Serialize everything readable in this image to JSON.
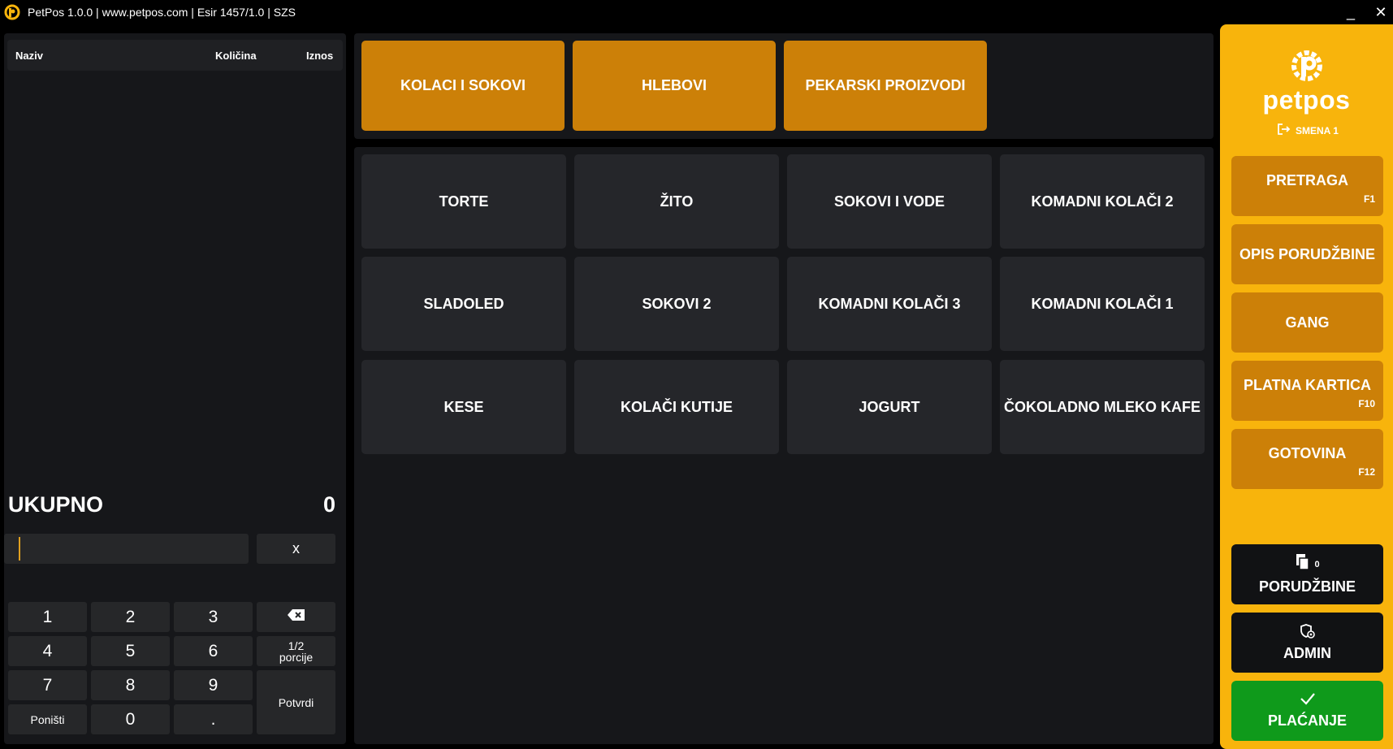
{
  "window": {
    "title": "PetPos 1.0.0 | www.petpos.com | Esir 1457/1.0 | SZS",
    "minimize": "_",
    "close": "✕"
  },
  "order": {
    "col_naziv": "Naziv",
    "col_kolicina": "Količina",
    "col_iznos": "Iznos",
    "total_label": "UKUPNO",
    "total_value": "0"
  },
  "keypad": {
    "clear_x": "x",
    "keys": [
      "1",
      "2",
      "3",
      "4",
      "5",
      "6",
      "7",
      "8",
      "9",
      "0",
      "."
    ],
    "half_line1": "1/2",
    "half_line2": "porcije",
    "cancel": "Poništi",
    "confirm": "Potvrdi"
  },
  "categories": [
    "KOLACI I SOKOVI",
    "HLEBOVI",
    "PEKARSKI PROIZVODI"
  ],
  "products": [
    "TORTE",
    "ŽITO",
    "SOKOVI I VODE",
    "KOMADNI KOLAČI 2",
    "SLADOLED",
    "SOKOVI 2",
    "KOMADNI KOLAČI 3",
    "KOMADNI KOLAČI 1",
    "KESE",
    "KOLAČI KUTIJE",
    "JOGURT",
    "ČOKOLADNO MLEKO KAFE"
  ],
  "sidebar": {
    "logo_text": "petpos",
    "shift": "SMENA 1",
    "pretraga": "PRETRAGA",
    "pretraga_key": "F1",
    "opis": "OPIS PORUDŽBINE",
    "gang": "GANG",
    "kartica": "PLATNA KARTICA",
    "kartica_key": "F10",
    "gotovina": "GOTOVINA",
    "gotovina_key": "F12",
    "porudzbine": "PORUDŽBINE",
    "porudzbine_count": "0",
    "admin": "ADMIN",
    "placanje": "PLAĆANJE"
  },
  "colors": {
    "accent_orange": "#cc8008",
    "sidebar_yellow": "#f8b40c",
    "pay_green": "#0f9a1b",
    "panel_bg": "#16171a",
    "tile_bg": "#25262a"
  }
}
